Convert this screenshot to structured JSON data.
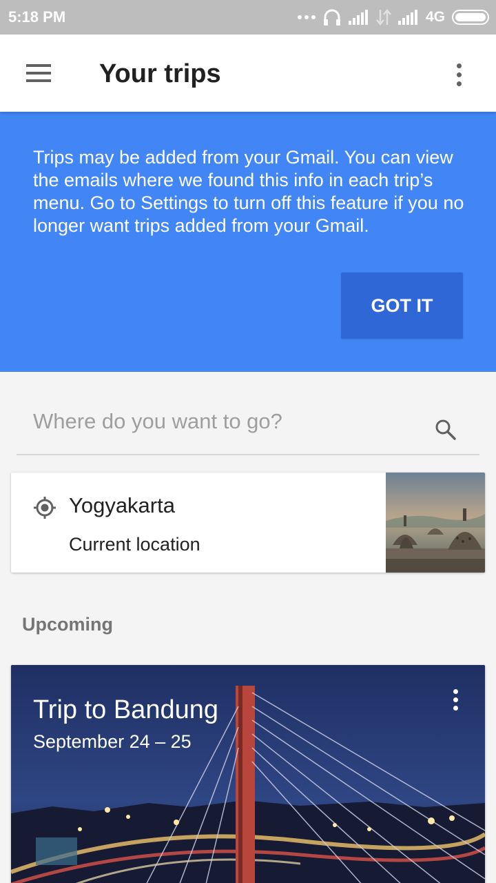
{
  "status_bar": {
    "time": "5:18 PM",
    "network": "4G",
    "icons": [
      "dots-icon",
      "headset-icon",
      "signal-icon",
      "data-icon",
      "signal-icon",
      "battery-icon"
    ]
  },
  "app_bar": {
    "title": "Your trips",
    "menu_icon": "hamburger-menu-icon",
    "overflow_icon": "more-vert-icon"
  },
  "banner": {
    "message": "Trips may be added from your Gmail. You can view the emails where we found this info in each trip’s menu. Go to Settings to turn off this feature if you no longer want trips added from your Gmail.",
    "button_label": "GOT IT",
    "background_color": "#4286f5",
    "button_color": "#3067d6"
  },
  "search": {
    "placeholder": "Where do you want to go?",
    "value": "",
    "icon": "search-icon"
  },
  "current_location": {
    "city": "Yogyakarta",
    "label": "Current location",
    "icon": "my-location-icon"
  },
  "sections": {
    "upcoming_label": "Upcoming"
  },
  "trip": {
    "title": "Trip to Bandung",
    "dates": "September 24 – 25",
    "menu_icon": "more-vert-icon"
  }
}
